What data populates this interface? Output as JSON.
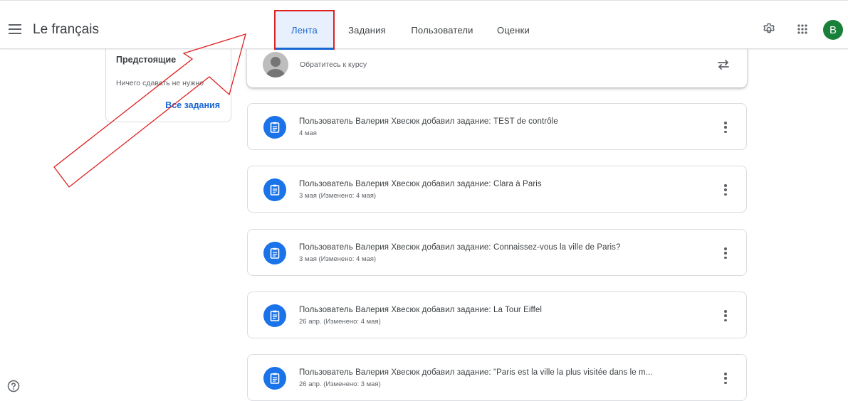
{
  "header": {
    "course_title": "Le français",
    "tabs": [
      {
        "label": "Лента",
        "active": true
      },
      {
        "label": "Задания",
        "active": false
      },
      {
        "label": "Пользователи",
        "active": false
      },
      {
        "label": "Оценки",
        "active": false
      }
    ],
    "avatar_letter": "В",
    "icons": [
      "menu-icon",
      "settings-icon",
      "apps-icon"
    ]
  },
  "upcoming": {
    "title": "Предстоящие",
    "empty_text": "Ничего сдавать не нужно",
    "all_link": "Все задания"
  },
  "announce": {
    "placeholder": "Обратитесь к курсу"
  },
  "stream": [
    {
      "title": "Пользователь Валерия Хвесюк добавил задание: TEST de contrôle",
      "date": "4 мая"
    },
    {
      "title": "Пользователь Валерия Хвесюк добавил задание: Clara à Paris",
      "date": "3 мая (Изменено: 4 мая)"
    },
    {
      "title": "Пользователь Валерия Хвесюк добавил задание: Connaissez-vous la ville de Paris?",
      "date": "3 мая (Изменено: 4 мая)"
    },
    {
      "title": "Пользователь Валерия Хвесюк добавил задание: La Tour Eiffel",
      "date": "26 апр. (Изменено: 4 мая)"
    },
    {
      "title": "Пользователь Валерия Хвесюк добавил задание: \"Paris est la ville la plus visitée dans le m...",
      "date": "26 апр. (Изменено: 3 мая)"
    }
  ],
  "colors": {
    "accent": "#1967d2",
    "assignment_icon_bg": "#1a73e8",
    "avatar_bg": "#188038",
    "annotation_red": "#e02020"
  }
}
